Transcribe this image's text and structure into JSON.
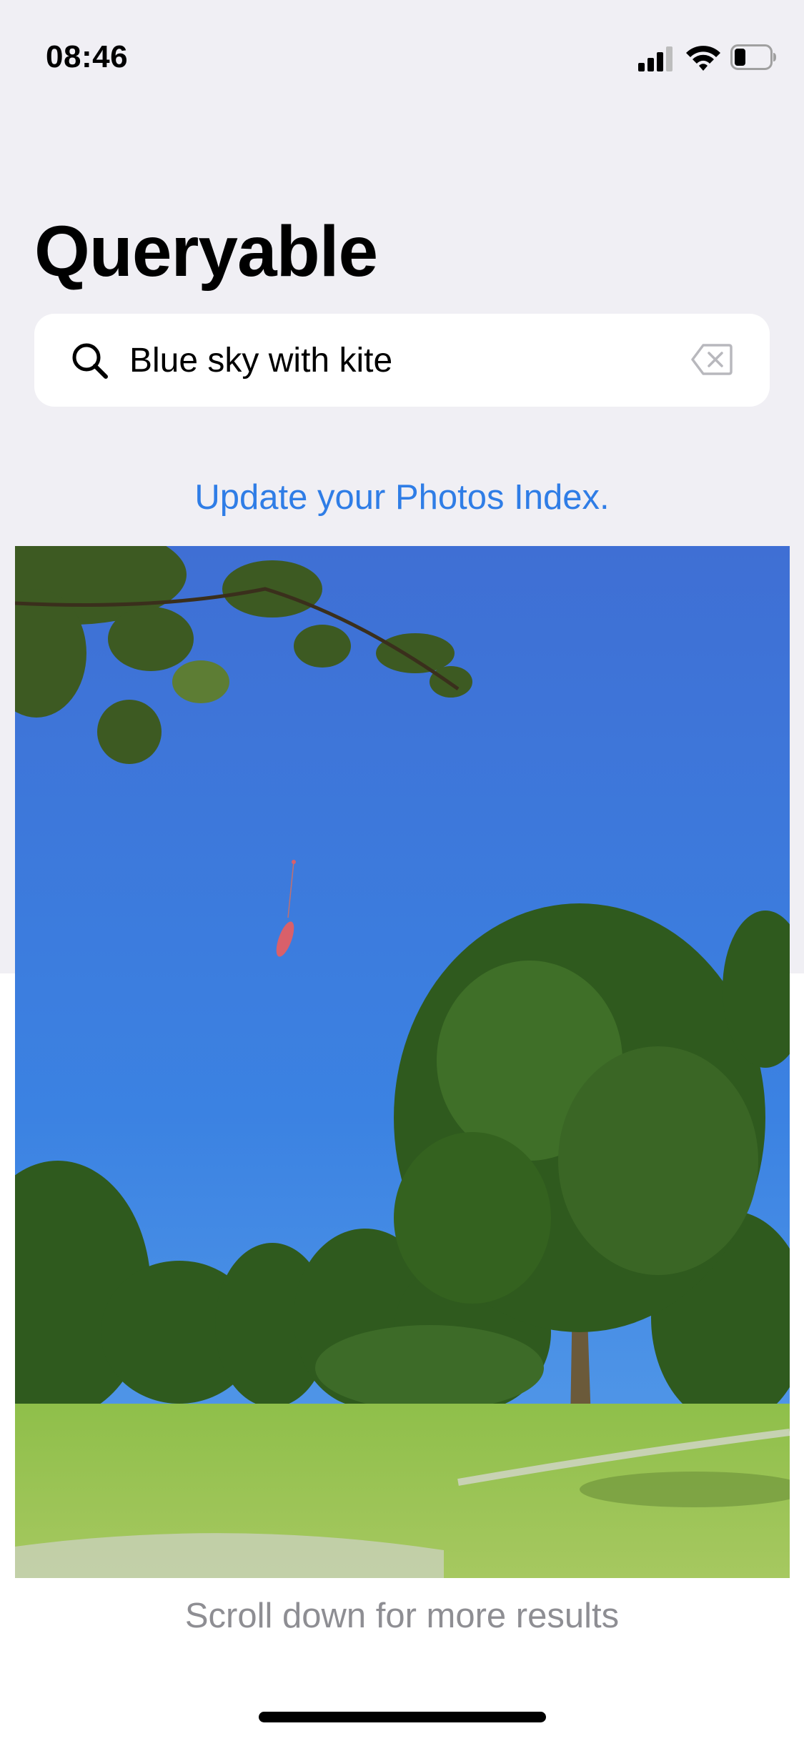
{
  "status_bar": {
    "time": "08:46"
  },
  "app": {
    "title": "Queryable"
  },
  "search": {
    "query": "Blue sky with kite"
  },
  "update_link": "Update your Photos Index.",
  "result": {
    "sky_color": "#3f7ad6"
  },
  "footer": {
    "scroll_hint": "Scroll down for more results"
  }
}
